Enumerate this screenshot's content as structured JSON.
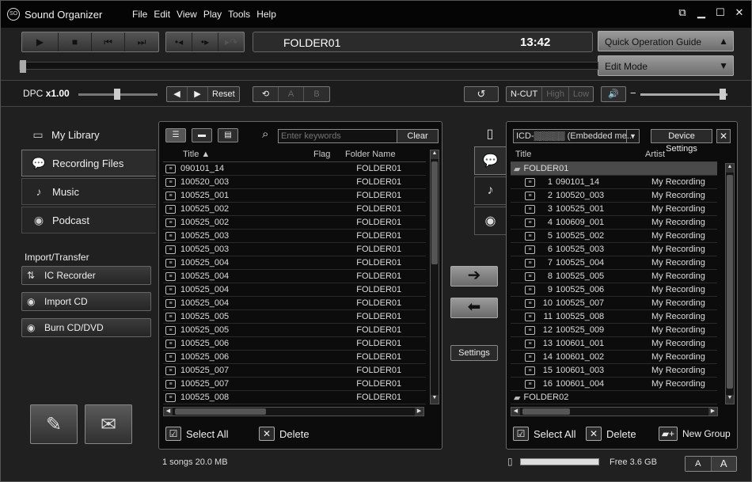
{
  "app": {
    "logo": "SO",
    "title": "Sound Organizer"
  },
  "menu": [
    "File",
    "Edit",
    "View",
    "Play",
    "Tools",
    "Help"
  ],
  "window_controls": [
    "⧉",
    "▁",
    "☐",
    "✕"
  ],
  "transport": {
    "play_group": [
      "▶",
      "■",
      "⏮",
      "⏭"
    ],
    "skip_group": [
      "•◂",
      "•▸",
      "▸↷"
    ],
    "display_folder": "FOLDER01",
    "display_time": "13:42",
    "quick_guide": "Quick Operation Guide",
    "edit_mode": "Edit Mode",
    "quick_arrow": "▲",
    "edit_arrow": "▼"
  },
  "controls": {
    "dpc_label": "DPC",
    "dpc_value": "x1.00",
    "dpc_buttons": [
      "◀",
      "▶",
      "Reset"
    ],
    "repeat_buttons": [
      "⟲",
      "A",
      "B"
    ],
    "ncut_label": "N-CUT",
    "ncut_buttons": [
      "High",
      "Low"
    ],
    "volume_icon": "🔊",
    "volume_minus": "−",
    "undo_icon": "↺"
  },
  "sidebar": {
    "my_library": "My Library",
    "items": [
      {
        "label": "Recording Files",
        "icon": "speech-bubble"
      },
      {
        "label": "Music",
        "icon": "music-note"
      },
      {
        "label": "Podcast",
        "icon": "podcast"
      }
    ],
    "section": "Import/Transfer",
    "actions": [
      {
        "label": "IC Recorder",
        "icon": "ic-recorder"
      },
      {
        "label": "Import CD",
        "icon": "cd-import"
      },
      {
        "label": "Burn CD/DVD",
        "icon": "cd-burn"
      }
    ]
  },
  "library": {
    "search_placeholder": "Enter keywords",
    "clear_label": "Clear",
    "columns": {
      "title": "Title ▲",
      "flag": "Flag",
      "folder": "Folder Name"
    },
    "rows": [
      {
        "title": "090101_14",
        "folder": "FOLDER01"
      },
      {
        "title": "100520_003",
        "folder": "FOLDER01"
      },
      {
        "title": "100525_001",
        "folder": "FOLDER01"
      },
      {
        "title": "100525_002",
        "folder": "FOLDER01"
      },
      {
        "title": "100525_002",
        "folder": "FOLDER01"
      },
      {
        "title": "100525_003",
        "folder": "FOLDER01"
      },
      {
        "title": "100525_003",
        "folder": "FOLDER01"
      },
      {
        "title": "100525_004",
        "folder": "FOLDER01"
      },
      {
        "title": "100525_004",
        "folder": "FOLDER01"
      },
      {
        "title": "100525_004",
        "folder": "FOLDER01"
      },
      {
        "title": "100525_004",
        "folder": "FOLDER01"
      },
      {
        "title": "100525_005",
        "folder": "FOLDER01"
      },
      {
        "title": "100525_005",
        "folder": "FOLDER01"
      },
      {
        "title": "100525_006",
        "folder": "FOLDER01"
      },
      {
        "title": "100525_006",
        "folder": "FOLDER01"
      },
      {
        "title": "100525_007",
        "folder": "FOLDER01"
      },
      {
        "title": "100525_007",
        "folder": "FOLDER01"
      },
      {
        "title": "100525_008",
        "folder": "FOLDER01"
      }
    ],
    "select_all": "Select All",
    "delete": "Delete",
    "status": "1 songs 20.0 MB"
  },
  "transfer": {
    "to_device": "➔",
    "to_library": "⬅",
    "settings": "Settings"
  },
  "device": {
    "selector": "ICD-▒▒▒▒▒ (Embedded me...",
    "device_settings": "Device Settings",
    "columns": {
      "title": "Title",
      "artist": "Artist"
    },
    "folder1": "FOLDER01",
    "folder2": "FOLDER02",
    "rows": [
      {
        "num": "1",
        "title": "090101_14",
        "artist": "My Recording"
      },
      {
        "num": "2",
        "title": "100520_003",
        "artist": "My Recording"
      },
      {
        "num": "3",
        "title": "100525_001",
        "artist": "My Recording"
      },
      {
        "num": "4",
        "title": "100609_001",
        "artist": "My Recording"
      },
      {
        "num": "5",
        "title": "100525_002",
        "artist": "My Recording"
      },
      {
        "num": "6",
        "title": "100525_003",
        "artist": "My Recording"
      },
      {
        "num": "7",
        "title": "100525_004",
        "artist": "My Recording"
      },
      {
        "num": "8",
        "title": "100525_005",
        "artist": "My Recording"
      },
      {
        "num": "9",
        "title": "100525_006",
        "artist": "My Recording"
      },
      {
        "num": "10",
        "title": "100525_007",
        "artist": "My Recording"
      },
      {
        "num": "11",
        "title": "100525_008",
        "artist": "My Recording"
      },
      {
        "num": "12",
        "title": "100525_009",
        "artist": "My Recording"
      },
      {
        "num": "13",
        "title": "100601_001",
        "artist": "My Recording"
      },
      {
        "num": "14",
        "title": "100601_002",
        "artist": "My Recording"
      },
      {
        "num": "15",
        "title": "100601_003",
        "artist": "My Recording"
      },
      {
        "num": "16",
        "title": "100601_004",
        "artist": "My Recording"
      }
    ],
    "select_all": "Select All",
    "delete": "Delete",
    "new_group": "New Group",
    "free_space": "Free 3.6 GB",
    "font_small": "A",
    "font_large": "A"
  }
}
